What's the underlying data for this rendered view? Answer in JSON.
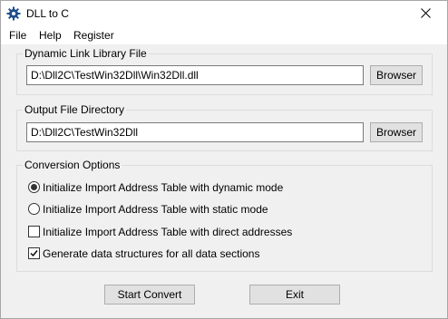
{
  "window": {
    "title": "DLL to C"
  },
  "icons": {
    "app": "gear-icon",
    "close": "close-icon",
    "check": "check-icon"
  },
  "menu": [
    "File",
    "Help",
    "Register"
  ],
  "dll_group": {
    "label": "Dynamic Link Library File",
    "value": "D:\\Dll2C\\TestWin32Dll\\Win32Dll.dll",
    "browse_label": "Browser"
  },
  "output_group": {
    "label": "Output File Directory",
    "value": "D:\\Dll2C\\TestWin32Dll",
    "browse_label": "Browser"
  },
  "options_group": {
    "label": "Conversion Options",
    "options": [
      {
        "type": "radio",
        "label": "Initialize Import Address Table with dynamic mode",
        "checked": true
      },
      {
        "type": "radio",
        "label": "Initialize Import Address Table with static mode",
        "checked": false
      },
      {
        "type": "checkbox",
        "label": "Initialize Import Address Table with direct addresses",
        "checked": false
      },
      {
        "type": "checkbox",
        "label": "Generate data structures for all data sections",
        "checked": true
      }
    ]
  },
  "buttons": {
    "start": "Start Convert",
    "exit": "Exit"
  }
}
